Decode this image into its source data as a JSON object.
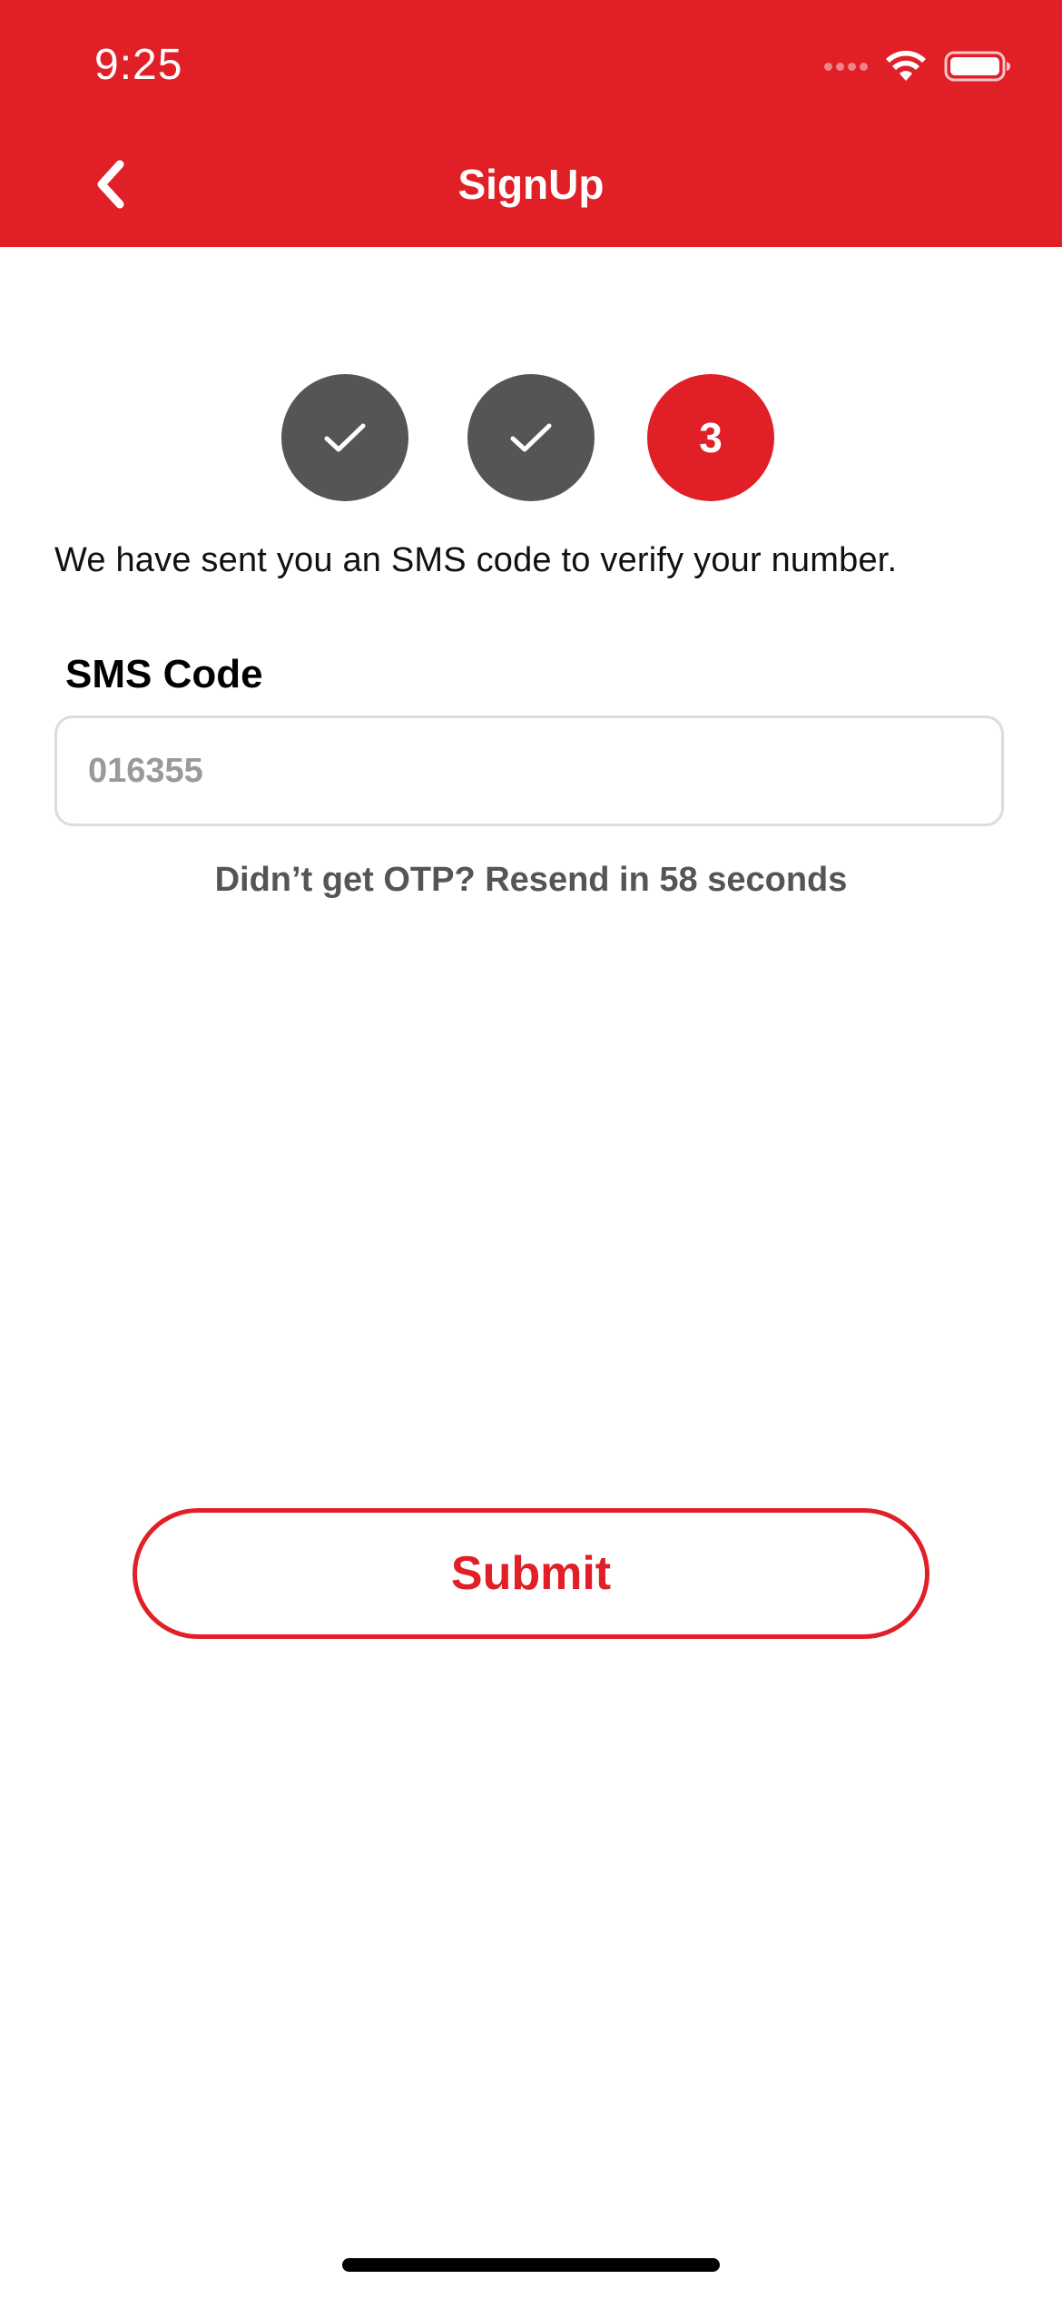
{
  "status_bar": {
    "time": "9:25"
  },
  "header": {
    "title": "SignUp",
    "background_color": "#e01f26",
    "back_icon": "chevron-left-icon"
  },
  "steps": [
    {
      "state": "done",
      "icon": "checkmark-icon"
    },
    {
      "state": "done",
      "icon": "checkmark-icon"
    },
    {
      "state": "active",
      "label": "3"
    }
  ],
  "info_text": "We have sent you an SMS code to verify your number.",
  "sms_field": {
    "label": "SMS Code",
    "placeholder": "016355",
    "value": ""
  },
  "resend_text": "Didn’t get OTP? Resend in 58 seconds",
  "submit": {
    "label": "Submit"
  },
  "colors": {
    "accent": "#e01f26",
    "step_done": "#555555",
    "muted_text": "#555555"
  }
}
